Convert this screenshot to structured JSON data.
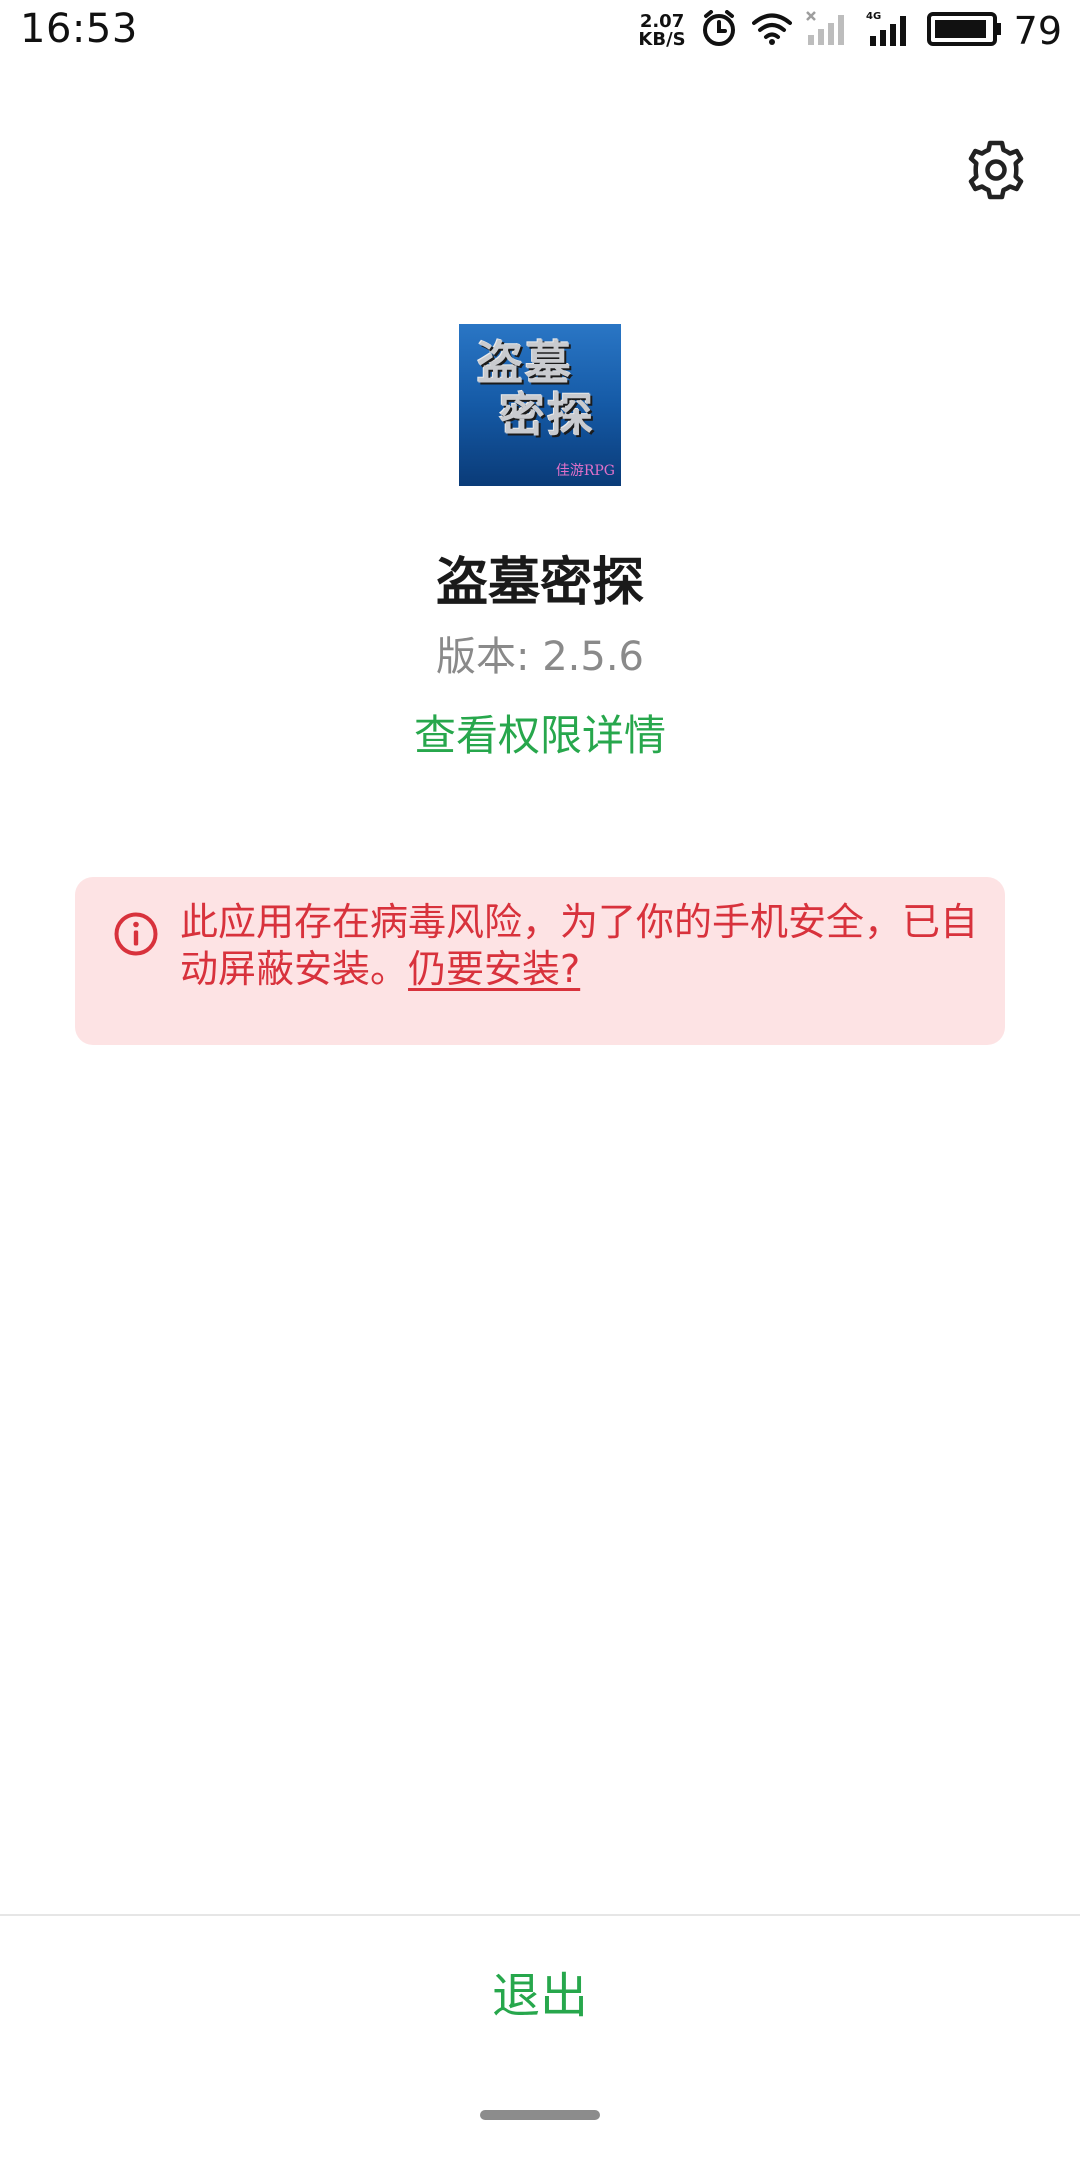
{
  "status_bar": {
    "time": "16:53",
    "net_speed_value": "2.07",
    "net_speed_unit": "KB/S",
    "network_type": "4G",
    "battery_level": "79",
    "icons": [
      "alarm-icon",
      "wifi-icon",
      "no-signal-sim1-icon",
      "signal-4g-icon",
      "battery-icon"
    ]
  },
  "header": {
    "settings_icon": "gear-icon"
  },
  "app": {
    "icon_text_line1": "盗墓",
    "icon_text_line2": "密探",
    "icon_tag": "佳游RPG",
    "name": "盗墓密探",
    "version": "版本: 2.5.6",
    "permission_link": "查看权限详情"
  },
  "warning": {
    "icon": "info-icon",
    "message": "此应用存在病毒风险，为了你的手机安全，已自动屏蔽安装。",
    "install_anyway_link": "仍要安装?",
    "text_color": "#d8323c",
    "background_color": "#fde3e4"
  },
  "footer": {
    "exit_label": "退出",
    "accent_color": "#27a74c"
  }
}
